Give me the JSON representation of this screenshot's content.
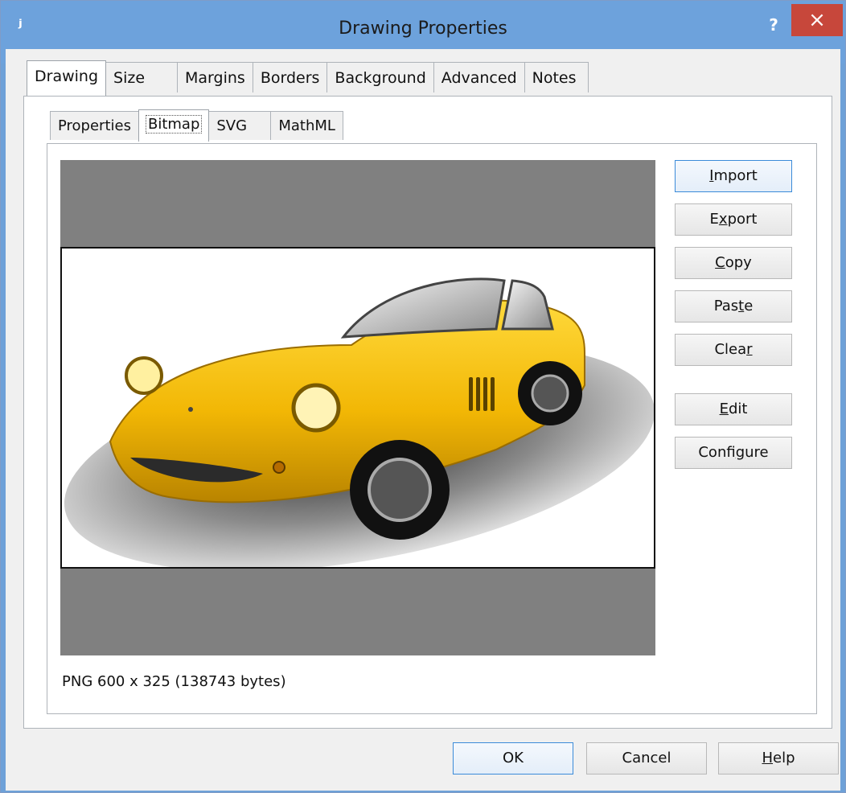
{
  "window": {
    "title": "Drawing Properties",
    "help_glyph": "?",
    "close_glyph": "×",
    "app_icon": "ʲ"
  },
  "top_tabs": [
    "Drawing",
    "Size",
    "Margins",
    "Borders",
    "Background",
    "Advanced",
    "Notes"
  ],
  "inner_tabs": [
    "Properties",
    "Bitmap",
    "SVG",
    "MathML"
  ],
  "buttons": {
    "import": {
      "pre": "",
      "acc": "I",
      "post": "mport"
    },
    "export": {
      "pre": "E",
      "acc": "x",
      "post": "port"
    },
    "copy": {
      "pre": "",
      "acc": "C",
      "post": "opy"
    },
    "paste": {
      "pre": "Pas",
      "acc": "t",
      "post": "e"
    },
    "clear": {
      "pre": "Clea",
      "acc": "r",
      "post": ""
    },
    "edit": {
      "pre": "",
      "acc": "E",
      "post": "dit"
    },
    "configure": {
      "pre": "Confi",
      "acc": "g",
      "post": "ure"
    }
  },
  "image_info": "PNG 600 x 325 (138743 bytes)",
  "footer": {
    "ok": "OK",
    "cancel": "Cancel",
    "help": {
      "pre": "",
      "acc": "H",
      "post": "elp"
    }
  },
  "colors": {
    "titlebar": "#6da2dc",
    "close": "#c7473b",
    "preview_bg": "#808080",
    "car_yellow": "#f2b705"
  }
}
